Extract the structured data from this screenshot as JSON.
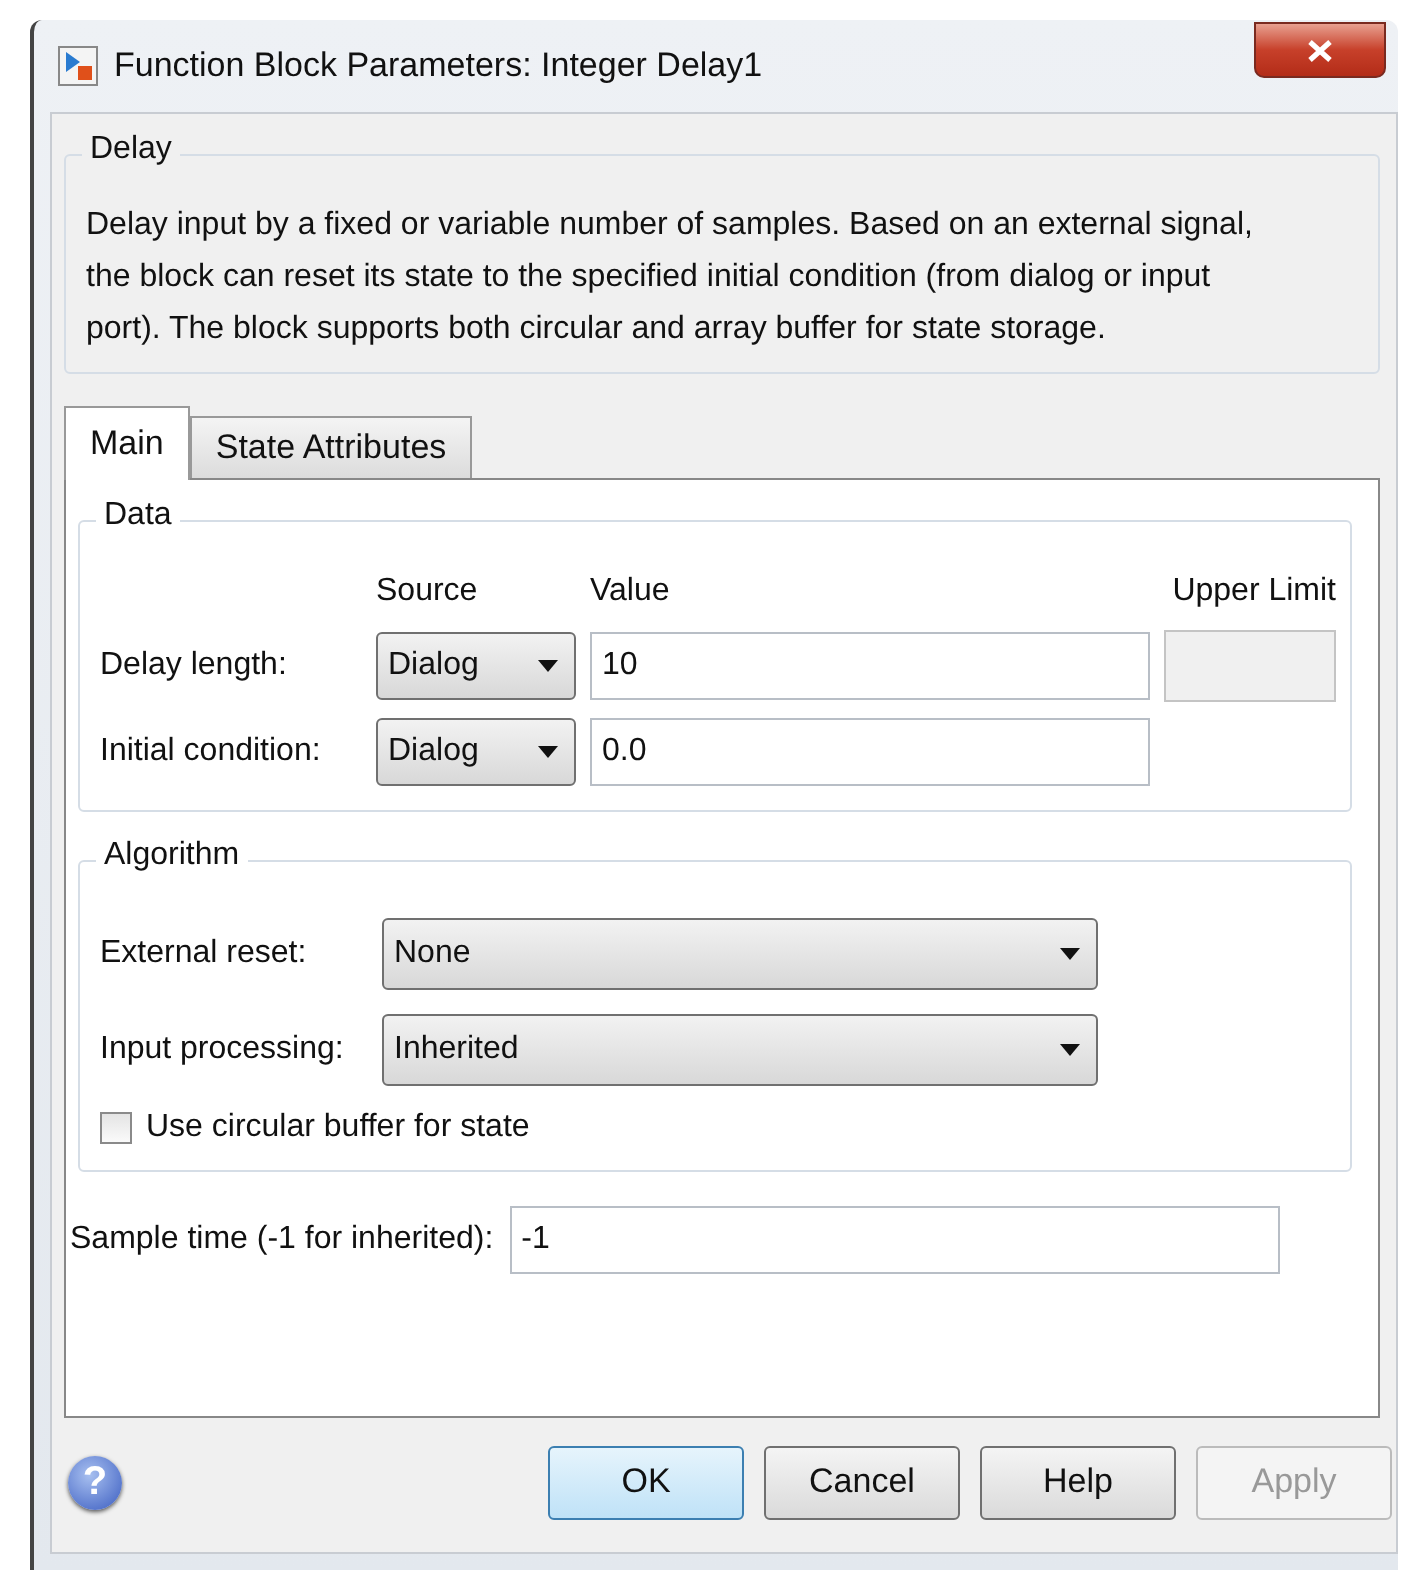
{
  "window": {
    "title": "Function Block Parameters: Integer Delay1"
  },
  "description": {
    "title": "Delay",
    "text": "Delay input by a fixed or variable number of samples. Based on an external signal, the block can reset its state to the specified initial condition (from dialog or input port). The block supports both circular and array buffer for state storage."
  },
  "tabs": [
    {
      "label": "Main",
      "selected": true
    },
    {
      "label": "State Attributes",
      "selected": false
    }
  ],
  "data_group": {
    "title": "Data",
    "columns": [
      "Source",
      "Value",
      "Upper Limit"
    ],
    "rows": [
      {
        "label": "Delay length:",
        "source": "Dialog",
        "value": "10",
        "upper_limit": {
          "disabled": true
        }
      },
      {
        "label": "Initial condition:",
        "source": "Dialog",
        "value": "0.0"
      }
    ]
  },
  "algorithm_group": {
    "title": "Algorithm",
    "dropdowns": [
      {
        "label": "External reset:",
        "value": "None"
      },
      {
        "label": "Input processing:",
        "value": "Inherited"
      }
    ],
    "checkbox": {
      "label": "Use circular buffer for state",
      "checked": false
    }
  },
  "sample_time": {
    "label": "Sample time (-1 for inherited):",
    "value": "-1"
  },
  "help_icon": "?",
  "buttons": [
    {
      "label": "OK",
      "default": true,
      "disabled": false
    },
    {
      "label": "Cancel",
      "default": false,
      "disabled": false
    },
    {
      "label": "Help",
      "default": false,
      "disabled": false
    },
    {
      "label": "Apply",
      "default": false,
      "disabled": true
    }
  ]
}
